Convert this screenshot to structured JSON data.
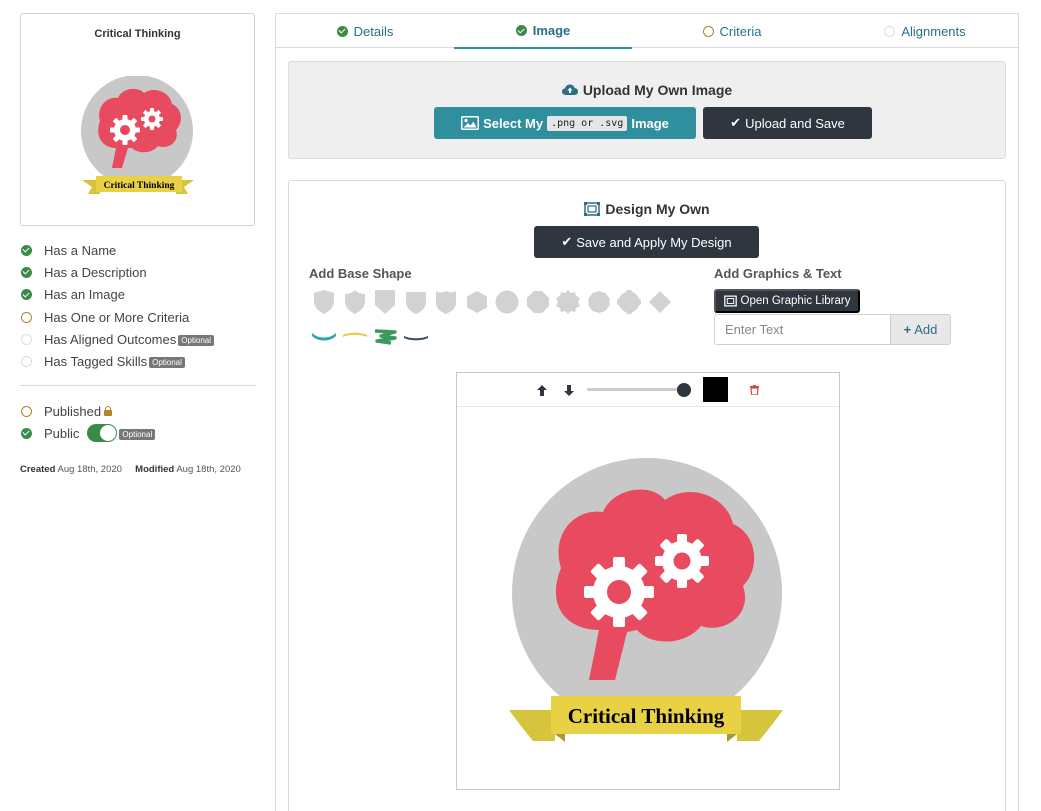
{
  "preview": {
    "title": "Critical Thinking",
    "badge_banner_text": "Critical Thinking"
  },
  "checklist": [
    {
      "label": "Has a Name",
      "status": "done",
      "optional": ""
    },
    {
      "label": "Has a Description",
      "status": "done",
      "optional": ""
    },
    {
      "label": "Has an Image",
      "status": "done",
      "optional": ""
    },
    {
      "label": "Has One or More Criteria",
      "status": "pending",
      "optional": ""
    },
    {
      "label": "Has Aligned Outcomes",
      "status": "empty",
      "optional": "Optional"
    },
    {
      "label": "Has Tagged Skills",
      "status": "empty",
      "optional": "Optional"
    }
  ],
  "publish": {
    "published_label": "Published",
    "public_label": "Public",
    "public_optional": "Optional",
    "public_enabled": true
  },
  "meta": {
    "created_label": "Created",
    "created_date": "Aug 18th, 2020",
    "modified_label": "Modified",
    "modified_date": "Aug 18th, 2020"
  },
  "tabs": [
    {
      "label": "Details",
      "status": "done"
    },
    {
      "label": "Image",
      "status": "done",
      "active": true
    },
    {
      "label": "Criteria",
      "status": "pending"
    },
    {
      "label": "Alignments",
      "status": "empty"
    }
  ],
  "upload": {
    "heading": "Upload My Own Image",
    "select_prefix": "Select My",
    "select_format": ".png or .svg",
    "select_suffix": "Image",
    "upload_save_label": "Upload and Save"
  },
  "design": {
    "heading": "Design My Own",
    "save_apply_label": "Save and Apply My Design",
    "base_shape_label": "Add Base Shape",
    "graphics_text_label": "Add Graphics & Text",
    "open_library_label": "Open Graphic Library",
    "text_placeholder": "Enter Text",
    "add_label": "Add",
    "canvas_text": "Critical Thinking"
  },
  "colors": {
    "accent_teal": "#2f8f9c",
    "dark_button": "#2f3640",
    "status_done": "#3c8a47",
    "status_pending": "#b5832b",
    "link_text": "#2b6f86",
    "brain_red": "#e84a5f",
    "circle_gray": "#c8c8c8",
    "banner_yellow": "#e8d144"
  }
}
